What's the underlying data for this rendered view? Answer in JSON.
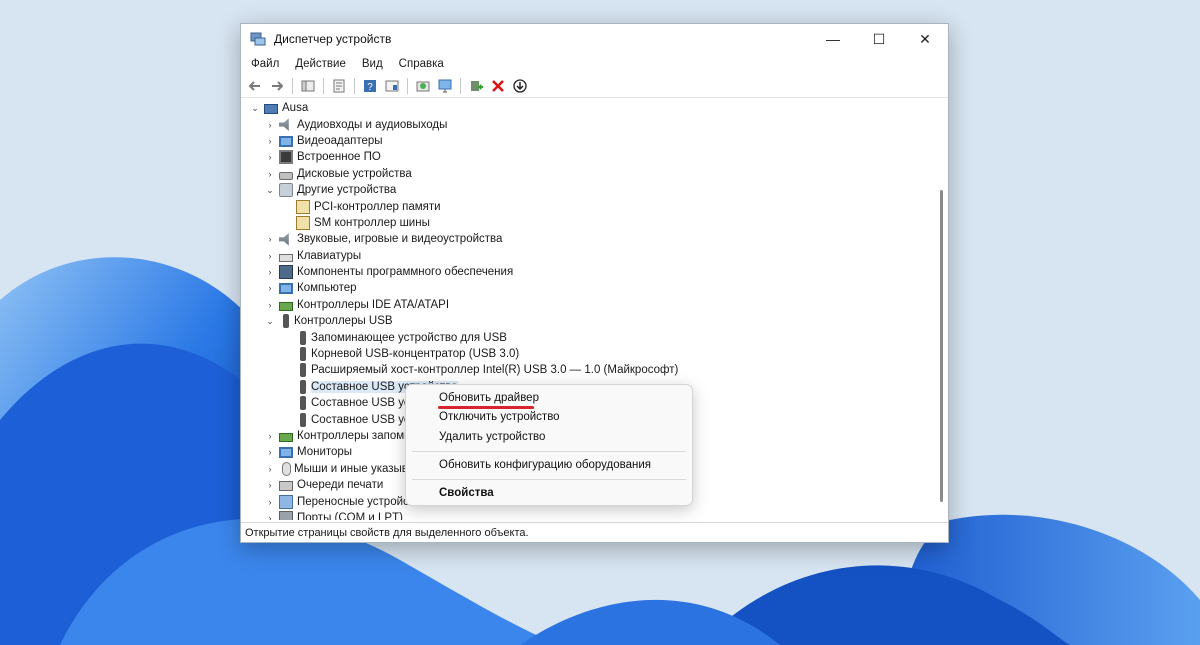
{
  "window": {
    "title": "Диспетчер устройств",
    "controls": {
      "minimize": "—",
      "maximize": "☐",
      "close": "✕"
    }
  },
  "menu": [
    "Файл",
    "Действие",
    "Вид",
    "Справка"
  ],
  "toolbar_icons": [
    "back-icon",
    "forward-icon",
    "show-hide-tree-icon",
    "properties-icon",
    "help-icon",
    "action-view-icon",
    "scan-changes-icon",
    "monitor-icon",
    "add-driver-icon",
    "uninstall-icon",
    "download-icon"
  ],
  "tree": [
    {
      "label": "Ausa",
      "level": 0,
      "expander": "⌄",
      "icon": "computer-icon"
    },
    {
      "label": "Аудиовходы и аудиовыходы",
      "level": 1,
      "expander": "›",
      "icon": "speaker-icon"
    },
    {
      "label": "Видеоадаптеры",
      "level": 1,
      "expander": "›",
      "icon": "display-adapter-icon"
    },
    {
      "label": "Встроенное ПО",
      "level": 1,
      "expander": "›",
      "icon": "firmware-icon"
    },
    {
      "label": "Дисковые устройства",
      "level": 1,
      "expander": "›",
      "icon": "disk-icon"
    },
    {
      "label": "Другие устройства",
      "level": 1,
      "expander": "⌄",
      "icon": "unknown-device-icon"
    },
    {
      "label": "PCI-контроллер памяти",
      "level": 2,
      "expander": "",
      "icon": "warning-device-icon"
    },
    {
      "label": "SM контроллер шины",
      "level": 2,
      "expander": "",
      "icon": "warning-device-icon"
    },
    {
      "label": "Звуковые, игровые и видеоустройства",
      "level": 1,
      "expander": "›",
      "icon": "speaker-icon"
    },
    {
      "label": "Клавиатуры",
      "level": 1,
      "expander": "›",
      "icon": "keyboard-icon"
    },
    {
      "label": "Компоненты программного обеспечения",
      "level": 1,
      "expander": "›",
      "icon": "software-component-icon"
    },
    {
      "label": "Компьютер",
      "level": 1,
      "expander": "›",
      "icon": "monitor-icon"
    },
    {
      "label": "Контроллеры IDE ATA/ATAPI",
      "level": 1,
      "expander": "›",
      "icon": "ide-icon"
    },
    {
      "label": "Контроллеры USB",
      "level": 1,
      "expander": "⌄",
      "icon": "usb-icon"
    },
    {
      "label": "Запоминающее устройство для USB",
      "level": 2,
      "expander": "",
      "icon": "usb-icon"
    },
    {
      "label": "Корневой USB-концентратор (USB 3.0)",
      "level": 2,
      "expander": "",
      "icon": "usb-icon"
    },
    {
      "label": "Расширяемый хост-контроллер Intel(R) USB 3.0 — 1.0 (Майкрософт)",
      "level": 2,
      "expander": "",
      "icon": "usb-icon"
    },
    {
      "label": "Составное USB устройство",
      "level": 2,
      "expander": "",
      "icon": "usb-icon",
      "selected": true
    },
    {
      "label": "Составное USB устройство",
      "level": 2,
      "expander": "",
      "icon": "usb-icon"
    },
    {
      "label": "Составное USB устройство",
      "level": 2,
      "expander": "",
      "icon": "usb-icon"
    },
    {
      "label": "Контроллеры запоминающих устройств",
      "level": 1,
      "expander": "›",
      "icon": "storage-controller-icon"
    },
    {
      "label": "Мониторы",
      "level": 1,
      "expander": "›",
      "icon": "monitor-icon"
    },
    {
      "label": "Мыши и иные указывающие устройства",
      "level": 1,
      "expander": "›",
      "icon": "mouse-icon"
    },
    {
      "label": "Очереди печати",
      "level": 1,
      "expander": "›",
      "icon": "printer-icon"
    },
    {
      "label": "Переносные устройства",
      "level": 1,
      "expander": "›",
      "icon": "portable-device-icon"
    },
    {
      "label": "Порты (COM и LPT)",
      "level": 1,
      "expander": "›",
      "icon": "ports-icon"
    }
  ],
  "context_menu": {
    "update_driver": "Обновить драйвер",
    "disable_device": "Отключить устройство",
    "uninstall_device": "Удалить устройство",
    "scan_hardware": "Обновить конфигурацию оборудования",
    "properties": "Свойства"
  },
  "status_text": "Открытие страницы свойств для выделенного объекта.",
  "colors": {
    "accent_underline": "#d8242c",
    "selection": "#dbe9f7",
    "wallpaper": "#1d5fd6"
  }
}
